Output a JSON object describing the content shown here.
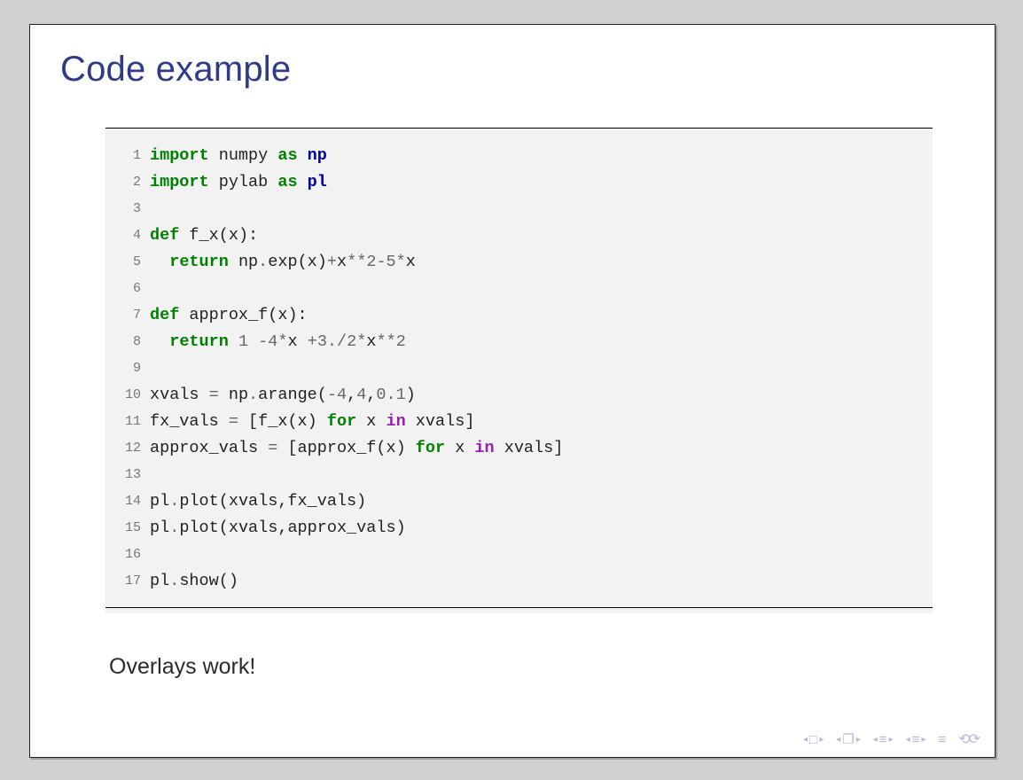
{
  "title": "Code example",
  "caption": "Overlays work!",
  "lines": [
    "1",
    "2",
    "3",
    "4",
    "5",
    "6",
    "7",
    "8",
    "9",
    "10",
    "11",
    "12",
    "13",
    "14",
    "15",
    "16",
    "17"
  ],
  "code": {
    "l1": {
      "a": "import",
      "b": " numpy ",
      "c": "as",
      "d": " np"
    },
    "l2": {
      "a": "import",
      "b": " pylab ",
      "c": "as",
      "d": " pl"
    },
    "l3": "",
    "l4": {
      "a": "def",
      "b": " f_x",
      "c": "(x):"
    },
    "l5": {
      "a": "  ",
      "b": "return",
      "c": " np",
      "d": ".",
      "e": "exp(x)",
      "f": "+",
      "g": "x",
      "h": "**",
      "i": "2",
      "j": "-",
      "k": "5",
      "l": "*",
      "m": "x"
    },
    "l6": "",
    "l7": {
      "a": "def",
      "b": " approx_f",
      "c": "(x):"
    },
    "l8": {
      "a": "  ",
      "b": "return",
      "c": " ",
      "d": "1",
      "e": " -",
      "f": "4",
      "g": "*",
      "h": "x ",
      "i": "+",
      "j": "3.",
      "k": "/",
      "l": "2",
      "m": "*",
      "n": "x",
      "o": "**",
      "p": "2"
    },
    "l9": "",
    "l10": {
      "a": "xvals ",
      "b": "=",
      "c": " np",
      "d": ".",
      "e": "arange(",
      "f": "-",
      "g": "4",
      "h": ",",
      "i": "4",
      "j": ",",
      "k": "0.1",
      "l": ")"
    },
    "l11": {
      "a": "fx_vals ",
      "b": "=",
      "c": " [f_x(x) ",
      "d": "for",
      "e": " x ",
      "f": "in",
      "g": " xvals]"
    },
    "l12": {
      "a": "approx_vals ",
      "b": "=",
      "c": " [approx_f(x) ",
      "d": "for",
      "e": " x ",
      "f": "in",
      "g": " xvals]"
    },
    "l13": "",
    "l14": {
      "a": "pl",
      "b": ".",
      "c": "plot(xvals,fx_vals)"
    },
    "l15": {
      "a": "pl",
      "b": ".",
      "c": "plot(xvals,approx_vals)"
    },
    "l16": "",
    "l17": {
      "a": "pl",
      "b": ".",
      "c": "show()"
    }
  },
  "nav": {
    "frame": "□",
    "pages": "❐",
    "sect": "≡",
    "subsect": "≡",
    "goto": "≡",
    "refresh": "⟲⟳"
  }
}
